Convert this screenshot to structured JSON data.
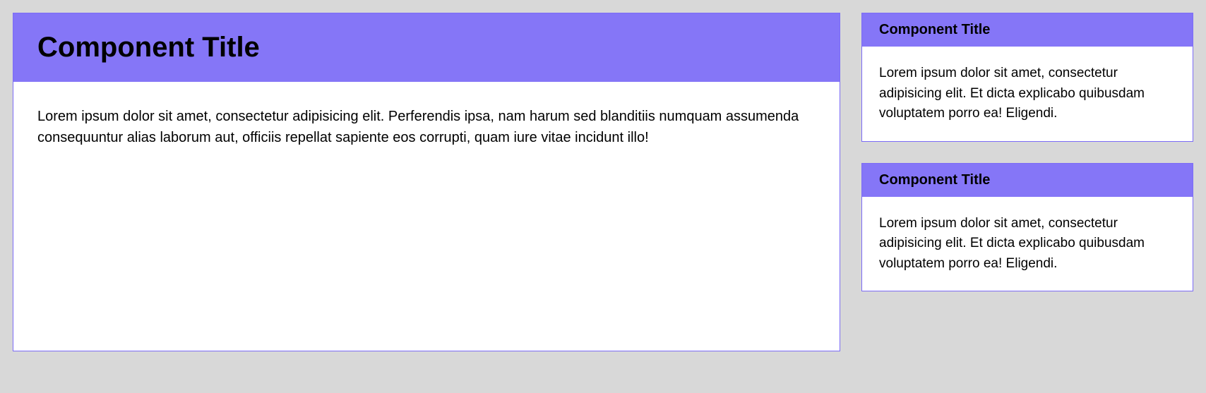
{
  "cards": {
    "main": {
      "title": "Component Title",
      "body": "Lorem ipsum dolor sit amet, consectetur adipisicing elit. Perferendis ipsa, nam harum sed blanditiis numquam assumenda consequuntur alias laborum aut, officiis repellat sapiente eos corrupti, quam iure vitae incidunt illo!"
    },
    "side": [
      {
        "title": "Component Title",
        "body": "Lorem ipsum dolor sit amet, consectetur adipisicing elit. Et dicta explicabo quibusdam voluptatem porro ea! Eligendi."
      },
      {
        "title": "Component Title",
        "body": "Lorem ipsum dolor sit amet, consectetur adipisicing elit. Et dicta explicabo quibusdam voluptatem porro ea! Eligendi."
      }
    ]
  }
}
